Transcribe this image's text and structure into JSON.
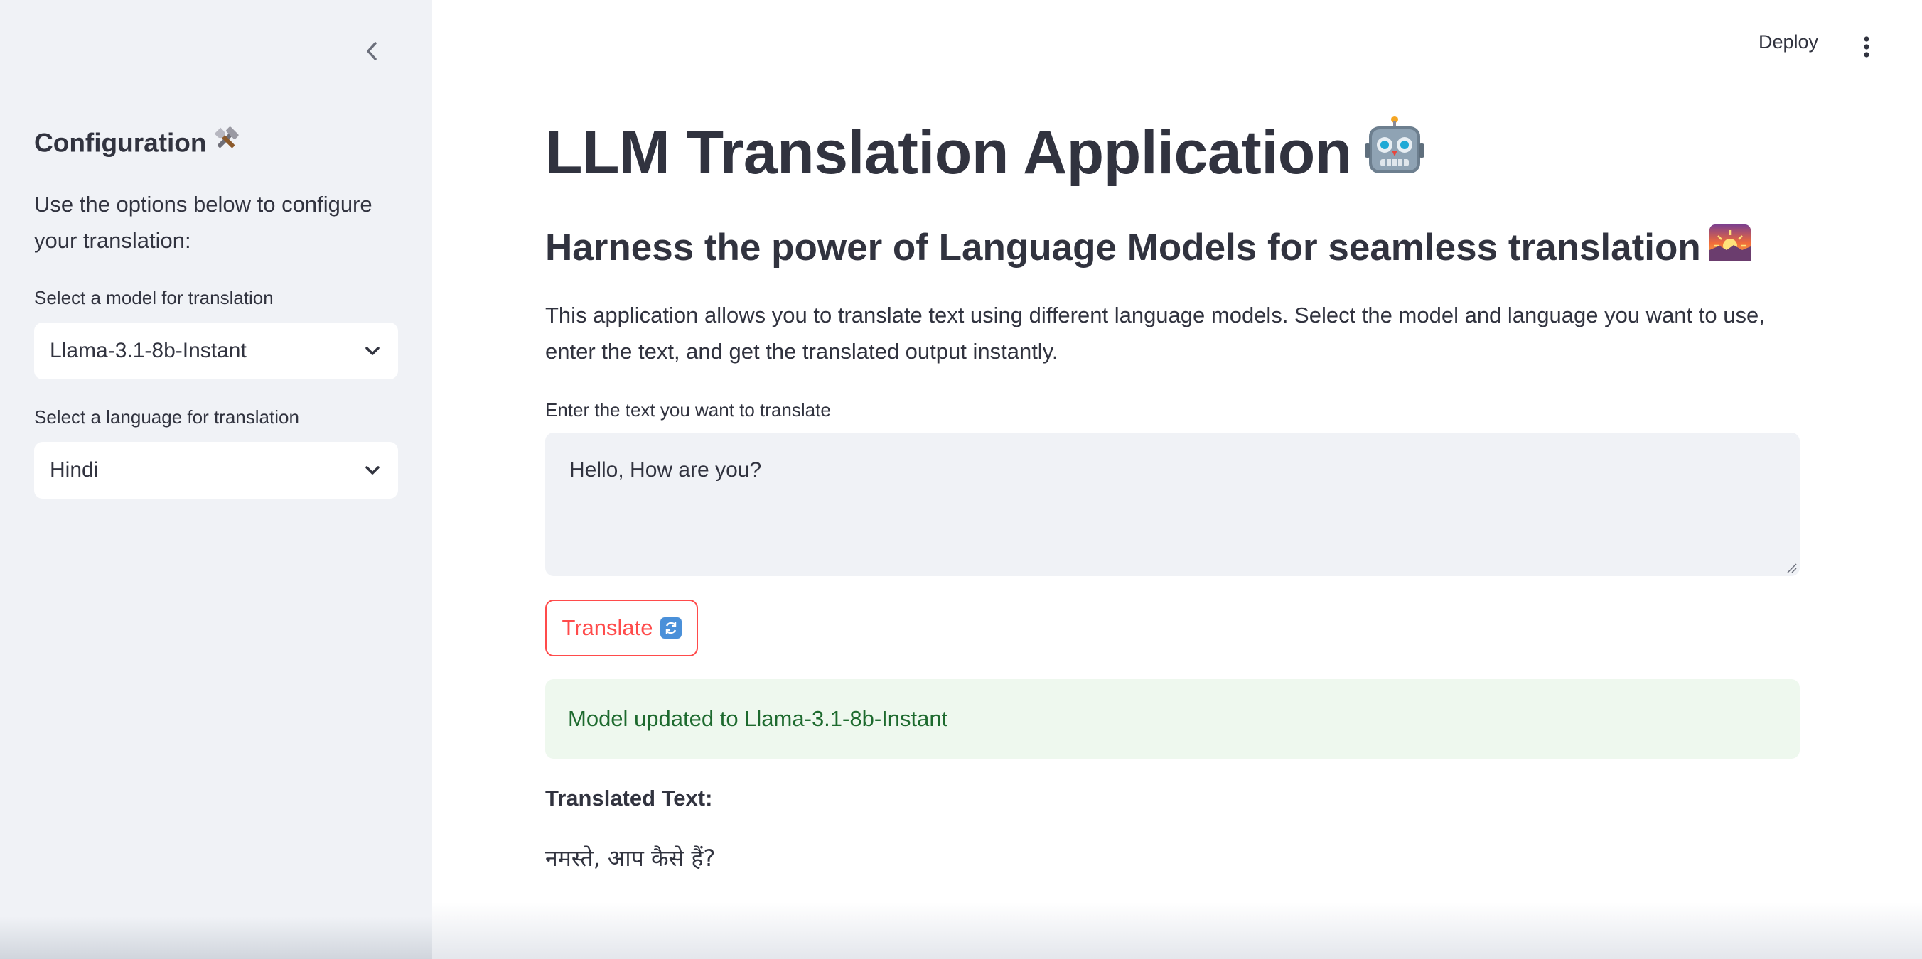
{
  "sidebar": {
    "title": "Configuration",
    "description": "Use the options below to configure your translation:",
    "model_label": "Select a model for translation",
    "model_value": "Llama-3.1-8b-Instant",
    "language_label": "Select a language for translation",
    "language_value": "Hindi"
  },
  "header": {
    "deploy_label": "Deploy"
  },
  "main": {
    "title": "LLM Translation Application",
    "subtitle": "Harness the power of Language Models for seamless translation",
    "description": "This application allows you to translate text using different language models. Select the model and language you want to use, enter the text, and get the translated output instantly.",
    "input_label": "Enter the text you want to translate",
    "input_value": "Hello, How are you?",
    "translate_label": "Translate",
    "success_message": "Model updated to Llama-3.1-8b-Instant",
    "output_label": "Translated Text:",
    "output_text": "नमस्ते, आप कैसे हैं?"
  },
  "icons": {
    "title_icon": "robot-icon",
    "subtitle_icon": "sunrise-icon",
    "config_icon": "tools-icon",
    "translate_icon": "refresh-icon"
  },
  "colors": {
    "accent": "#ff4b4b",
    "sidebar_bg": "#f0f2f6",
    "success_bg": "#eef8ee",
    "success_text": "#1d6a2e",
    "text": "#31333f"
  }
}
